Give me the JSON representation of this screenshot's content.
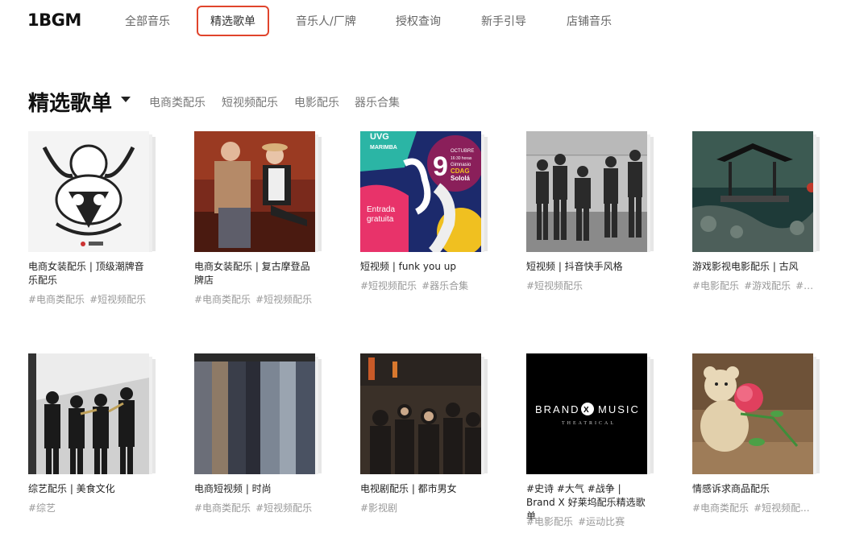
{
  "logo": "1BGM",
  "nav": {
    "items": [
      "全部音乐",
      "精选歌单",
      "音乐人/厂牌",
      "授权查询",
      "新手引导",
      "店铺音乐"
    ],
    "active": "精选歌单"
  },
  "section": {
    "title": "精选歌单",
    "subtabs": [
      "电商类配乐",
      "短视频配乐",
      "电影配乐",
      "器乐合集"
    ]
  },
  "cards": [
    {
      "title": "电商女装配乐 | 顶级潮牌音乐配乐",
      "tags": [
        "#电商类配乐",
        "#短视频配乐"
      ]
    },
    {
      "title": "电商女装配乐 | 复古摩登品牌店",
      "tags": [
        "#电商类配乐",
        "#短视频配乐"
      ]
    },
    {
      "title": "短视频 | funk you up",
      "tags": [
        "#短视频配乐",
        "#器乐合集"
      ],
      "cover_text": {
        "l1": "UVG",
        "l2": "MARIMBA",
        "l3": "9",
        "l4": "OCTUBRE",
        "l5": "16:30 horas",
        "l6": "Gimnasio",
        "l7": "CDAG",
        "l8": "Sololá",
        "l9": "Entrada",
        "l10": "gratuita"
      }
    },
    {
      "title": "短视频 | 抖音快手风格",
      "tags": [
        "#短视频配乐"
      ]
    },
    {
      "title": "游戏影视电影配乐 | 古风",
      "tags": [
        "#电影配乐",
        "#游戏配乐",
        "#…"
      ]
    },
    {
      "title": "综艺配乐 | 美食文化",
      "tags": [
        "#综艺"
      ]
    },
    {
      "title": "电商短视频 | 时尚",
      "tags": [
        "#电商类配乐",
        "#短视频配乐"
      ]
    },
    {
      "title": "电视剧配乐 | 都市男女",
      "tags": [
        "#影视剧"
      ]
    },
    {
      "title": "#史诗 #大气 #战争 | Brand X 好莱坞配乐精选歌单",
      "tags": [
        "#电影配乐",
        "#运动比赛"
      ],
      "cover_text": {
        "brand": "BRAND",
        "music": "MUSIC",
        "x": "X",
        "sub": "THEATRICAL"
      }
    },
    {
      "title": "情感诉求商品配乐",
      "tags": [
        "#电商类配乐",
        "#短视频配..."
      ]
    }
  ]
}
